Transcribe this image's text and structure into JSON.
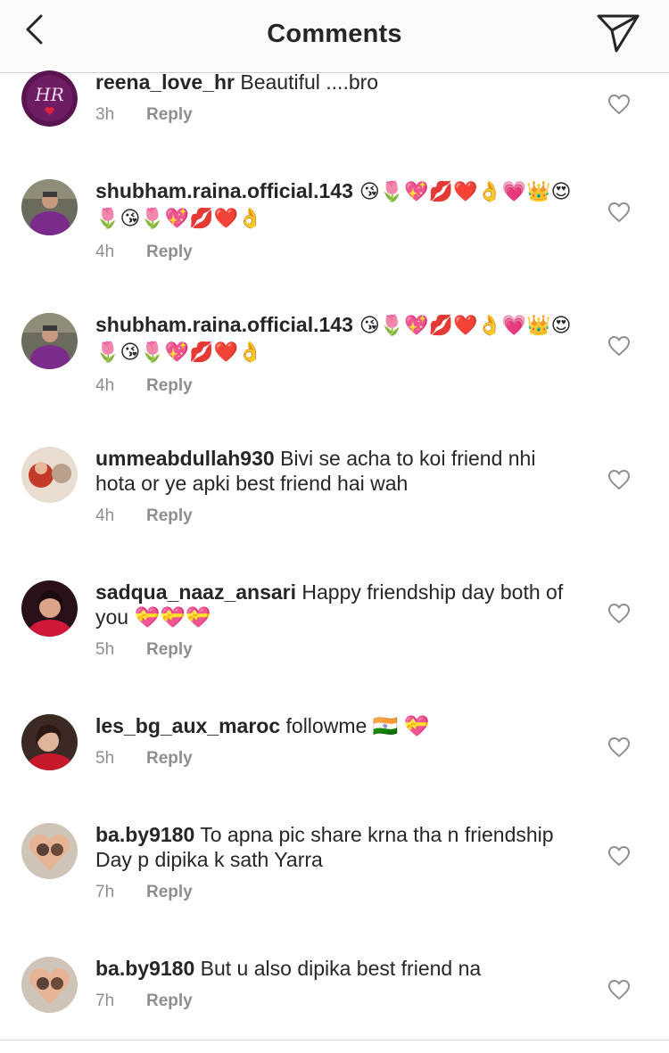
{
  "header": {
    "title": "Comments",
    "back_icon": "chevron-left-icon",
    "share_icon": "paper-plane-icon"
  },
  "colors": {
    "text": "#262626",
    "muted": "#8e8e8e",
    "header_bg": "#fafafa"
  },
  "comments": [
    {
      "username": "reena_love_hr",
      "text": " Beautiful ....bro",
      "time": "3h",
      "reply": "Reply",
      "avatar_text": "HR"
    },
    {
      "username": "shubham.raina.official.143",
      "text": " 😘🌷💖💋❤️👌💗👑😍🌷😘🌷💖💋❤️👌",
      "time": "4h",
      "reply": "Reply"
    },
    {
      "username": "shubham.raina.official.143",
      "text": " 😘🌷💖💋❤️👌💗👑😍🌷😘🌷💖💋❤️👌",
      "time": "4h",
      "reply": "Reply"
    },
    {
      "username": "ummeabdullah930",
      "text": " Bivi se acha to koi friend nhi hota or ye apki best friend hai wah",
      "time": "4h",
      "reply": "Reply"
    },
    {
      "username": "sadqua_naaz_ansari",
      "text": " Happy friendship day both of you 💝💝💝",
      "time": "5h",
      "reply": "Reply"
    },
    {
      "username": "les_bg_aux_maroc",
      "text": " followme 🇮🇳 💝",
      "time": "5h",
      "reply": "Reply"
    },
    {
      "username": "ba.by9180",
      "text": " To apna pic share krna tha n friendship Day p dipika k sath Yarra",
      "time": "7h",
      "reply": "Reply"
    },
    {
      "username": "ba.by9180",
      "text": " But u also dipika best friend na",
      "time": "7h",
      "reply": "Reply"
    }
  ]
}
